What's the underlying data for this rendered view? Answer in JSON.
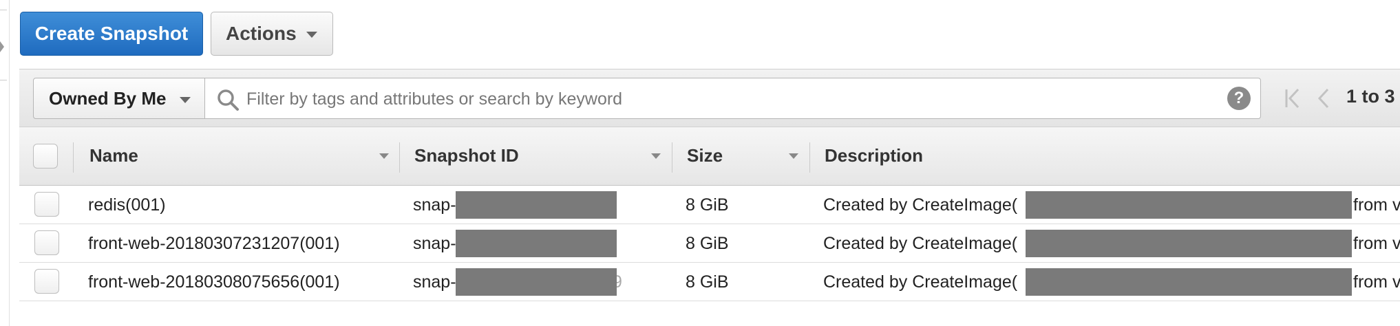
{
  "toolbar": {
    "create_label": "Create Snapshot",
    "actions_label": "Actions"
  },
  "filter": {
    "owner_label": "Owned By Me",
    "search_placeholder": "Filter by tags and attributes or search by keyword",
    "help_glyph": "?",
    "pagination": "1 to 3"
  },
  "table": {
    "headers": {
      "name": "Name",
      "snapshot_id": "Snapshot ID",
      "size": "Size",
      "description": "Description"
    },
    "rows": [
      {
        "name": "redis(001)",
        "snapshot_id_prefix": "snap-",
        "snapshot_id_suffix": "",
        "size": "8 GiB",
        "description_prefix": "Created by CreateImage(",
        "description_suffix": "from v"
      },
      {
        "name": "front-web-20180307231207(001)",
        "snapshot_id_prefix": "snap-",
        "snapshot_id_suffix": "",
        "size": "8 GiB",
        "description_prefix": "Created by CreateImage(",
        "description_suffix": "from v"
      },
      {
        "name": "front-web-20180308075656(001)",
        "snapshot_id_prefix": "snap-",
        "snapshot_id_suffix": "9",
        "size": "8 GiB",
        "description_prefix": "Created by CreateImage(",
        "description_suffix": "from v"
      }
    ]
  },
  "icons": {
    "search": "search-icon",
    "help": "help-icon",
    "first_page": "first-page-icon",
    "prev_page": "previous-page-icon",
    "dropdown": "chevron-down-icon",
    "sort": "sort-caret-icon"
  },
  "colors": {
    "primary": "#1f6bbf",
    "redaction": "#7a7a7a",
    "header_bg": "#e6e6e6"
  }
}
